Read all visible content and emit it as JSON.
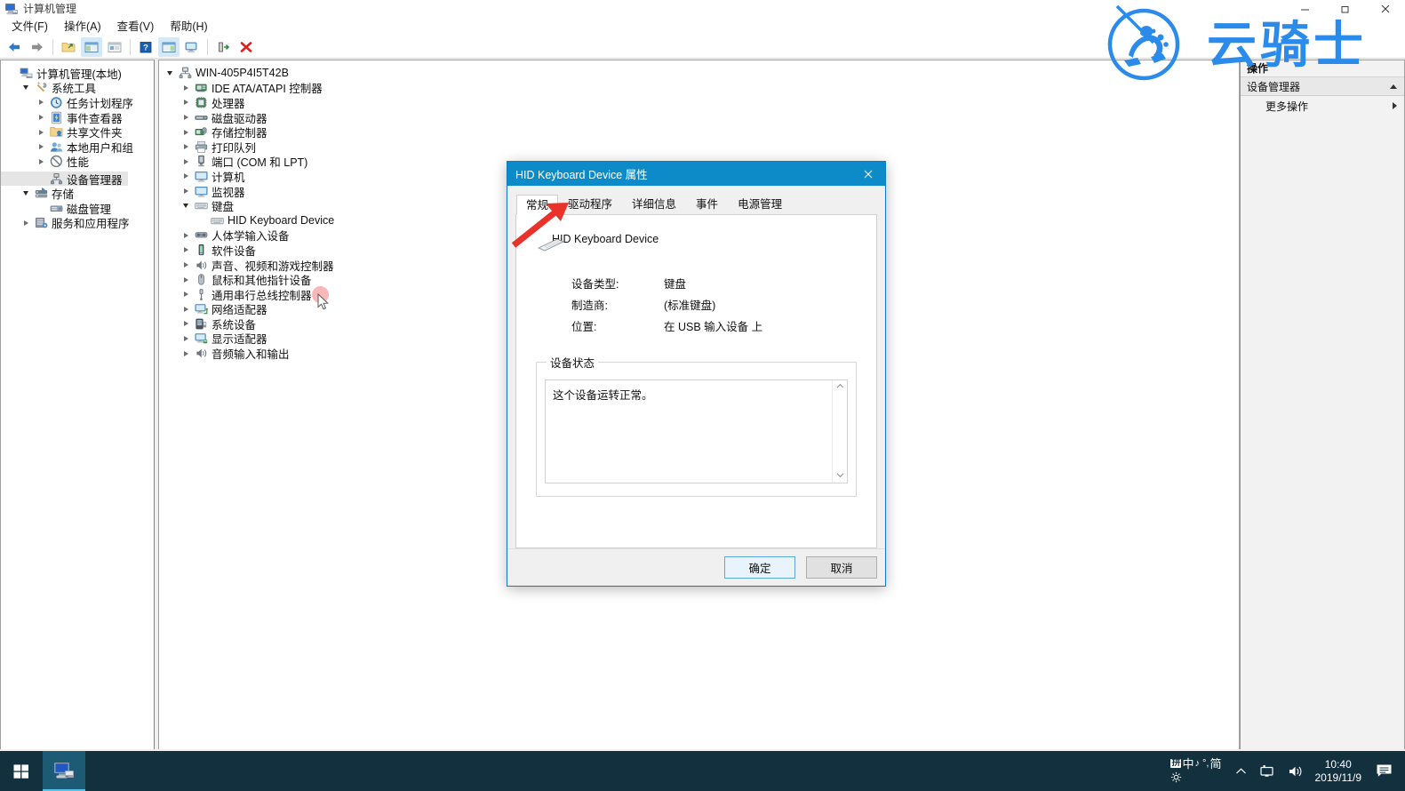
{
  "window": {
    "title": "计算机管理",
    "icon": "computer-management-icon",
    "minimize": "—",
    "maximize": "▢",
    "close": "✕"
  },
  "menubar": {
    "items": [
      {
        "label": "文件(F)",
        "name": "menu-file"
      },
      {
        "label": "操作(A)",
        "name": "menu-action"
      },
      {
        "label": "查看(V)",
        "name": "menu-view"
      },
      {
        "label": "帮助(H)",
        "name": "menu-help"
      }
    ]
  },
  "toolbar": {
    "buttons": [
      {
        "name": "back-button",
        "icon": "arrow-left-icon"
      },
      {
        "name": "forward-button",
        "icon": "arrow-right-icon"
      },
      {
        "name": "up-folder-button",
        "icon": "folder-up-icon"
      },
      {
        "name": "show-hide-console-tree-button",
        "icon": "console-tree-icon"
      },
      {
        "name": "properties-button",
        "icon": "properties-icon"
      },
      {
        "name": "help-button",
        "icon": "help-question-icon"
      },
      {
        "name": "show-hide-action-pane-button",
        "icon": "action-pane-icon"
      },
      {
        "name": "scan-hardware-changes-button",
        "icon": "monitor-icon"
      },
      {
        "name": "update-driver-button",
        "icon": "update-driver-icon"
      },
      {
        "name": "uninstall-device-button",
        "icon": "red-x-icon"
      }
    ]
  },
  "console_tree": {
    "nodes": [
      {
        "label": "计算机管理(本地)",
        "indent": 0,
        "twisty": "none",
        "icon": "computer-management-icon",
        "selected": false
      },
      {
        "label": "系统工具",
        "indent": 1,
        "twisty": "down",
        "icon": "tools-icon",
        "selected": false
      },
      {
        "label": "任务计划程序",
        "indent": 2,
        "twisty": "right",
        "icon": "clock-icon",
        "selected": false
      },
      {
        "label": "事件查看器",
        "indent": 2,
        "twisty": "right",
        "icon": "event-viewer-icon",
        "selected": false
      },
      {
        "label": "共享文件夹",
        "indent": 2,
        "twisty": "right",
        "icon": "shared-folder-icon",
        "selected": false
      },
      {
        "label": "本地用户和组",
        "indent": 2,
        "twisty": "right",
        "icon": "users-icon",
        "selected": false
      },
      {
        "label": "性能",
        "indent": 2,
        "twisty": "right",
        "icon": "performance-icon",
        "selected": false
      },
      {
        "label": "设备管理器",
        "indent": 2,
        "twisty": "none",
        "icon": "device-manager-icon",
        "selected": true
      },
      {
        "label": "存储",
        "indent": 1,
        "twisty": "down",
        "icon": "storage-icon",
        "selected": false
      },
      {
        "label": "磁盘管理",
        "indent": 2,
        "twisty": "none",
        "icon": "disk-management-icon",
        "selected": false
      },
      {
        "label": "服务和应用程序",
        "indent": 1,
        "twisty": "right",
        "icon": "services-icon",
        "selected": false
      }
    ]
  },
  "device_tree": {
    "nodes": [
      {
        "label": "WIN-405P4I5T42B",
        "indent": 0,
        "twisty": "down",
        "icon": "computer-node-icon"
      },
      {
        "label": "IDE ATA/ATAPI 控制器",
        "indent": 1,
        "twisty": "right",
        "icon": "ide-controller-icon"
      },
      {
        "label": "处理器",
        "indent": 1,
        "twisty": "right",
        "icon": "processor-icon"
      },
      {
        "label": "磁盘驱动器",
        "indent": 1,
        "twisty": "right",
        "icon": "disk-drive-icon"
      },
      {
        "label": "存储控制器",
        "indent": 1,
        "twisty": "right",
        "icon": "storage-controller-icon"
      },
      {
        "label": "打印队列",
        "indent": 1,
        "twisty": "right",
        "icon": "printer-icon"
      },
      {
        "label": "端口 (COM 和 LPT)",
        "indent": 1,
        "twisty": "right",
        "icon": "port-icon"
      },
      {
        "label": "计算机",
        "indent": 1,
        "twisty": "right",
        "icon": "monitor-blue-icon"
      },
      {
        "label": "监视器",
        "indent": 1,
        "twisty": "right",
        "icon": "monitor-blue-icon"
      },
      {
        "label": "键盘",
        "indent": 1,
        "twisty": "down",
        "icon": "keyboard-icon"
      },
      {
        "label": "HID Keyboard Device",
        "indent": 2,
        "twisty": "none",
        "icon": "keyboard-icon"
      },
      {
        "label": "人体学输入设备",
        "indent": 1,
        "twisty": "right",
        "icon": "hid-icon"
      },
      {
        "label": "软件设备",
        "indent": 1,
        "twisty": "right",
        "icon": "software-device-icon"
      },
      {
        "label": "声音、视频和游戏控制器",
        "indent": 1,
        "twisty": "right",
        "icon": "speaker-icon"
      },
      {
        "label": "鼠标和其他指针设备",
        "indent": 1,
        "twisty": "right",
        "icon": "mouse-icon"
      },
      {
        "label": "通用串行总线控制器",
        "indent": 1,
        "twisty": "right",
        "icon": "usb-icon"
      },
      {
        "label": "网络适配器",
        "indent": 1,
        "twisty": "right",
        "icon": "network-adapter-icon"
      },
      {
        "label": "系统设备",
        "indent": 1,
        "twisty": "right",
        "icon": "system-device-icon"
      },
      {
        "label": "显示适配器",
        "indent": 1,
        "twisty": "right",
        "icon": "display-adapter-icon"
      },
      {
        "label": "音频输入和输出",
        "indent": 1,
        "twisty": "right",
        "icon": "speaker-icon"
      }
    ]
  },
  "actions_pane": {
    "header": "操作",
    "group_label": "设备管理器",
    "group_collapse_icon": "triangle-up-icon",
    "items": [
      {
        "label": "更多操作",
        "submenu_icon": "triangle-right-icon"
      }
    ]
  },
  "dialog": {
    "title": "HID Keyboard Device 属性",
    "close_label": "✕",
    "tabs": [
      {
        "label": "常规",
        "active": true
      },
      {
        "label": "驱动程序",
        "active": false
      },
      {
        "label": "详细信息",
        "active": false
      },
      {
        "label": "事件",
        "active": false
      },
      {
        "label": "电源管理",
        "active": false
      }
    ],
    "device_name": "HID Keyboard Device",
    "device_icon": "keyboard-icon",
    "properties": [
      {
        "key": "设备类型:",
        "value": "键盘"
      },
      {
        "key": "制造商:",
        "value": "(标准键盘)"
      },
      {
        "key": "位置:",
        "value": "在 USB 输入设备 上"
      }
    ],
    "status_legend": "设备状态",
    "status_text": "这个设备运转正常。",
    "scroll_up": "⌃",
    "scroll_down": "⌄",
    "buttons": {
      "ok": "确定",
      "cancel": "取消"
    }
  },
  "annotation": {
    "arrow": "red-arrow-pointing-to-driver-tab",
    "color": "#e8322a"
  },
  "watermark": {
    "text": "云骑士",
    "color": "#2a8bea",
    "logo": "knight-rider-circle-logo"
  },
  "taskbar": {
    "start_icon": "windows-start-icon",
    "apps": [
      {
        "name": "computer-management-taskbar-item",
        "icon": "computer-management-icon",
        "active": true
      }
    ],
    "tray": {
      "ime_badge": "拼",
      "ime_mode": "中",
      "ime_extra": "♪ °,",
      "ime_simplified": "简",
      "ime_settings_icon": "gear-icon",
      "chevron_up": "⌃",
      "network_icon": "network-monitor-icon",
      "volume_icon": "speaker-icon",
      "time": "10:40",
      "date": "2019/11/9",
      "action_center_icon": "action-center-icon"
    }
  },
  "colors": {
    "dialog_header": "#0d8bc9",
    "taskbar": "#13303f",
    "accent": "#0078d7",
    "annotation_red": "#e8322a",
    "watermark_blue": "#2a8bea"
  }
}
